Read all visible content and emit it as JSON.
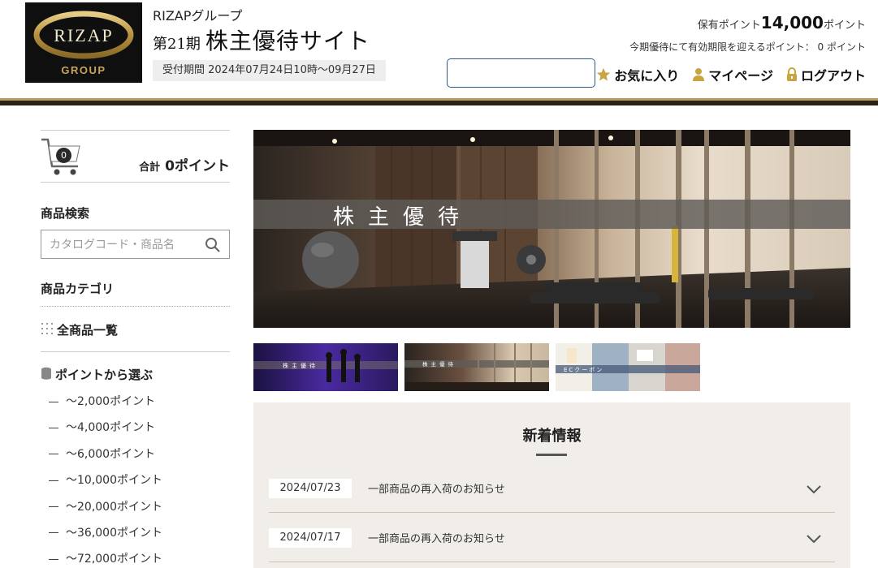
{
  "header": {
    "logo_text": "RIZAP",
    "logo_sub": "GROUP",
    "group_name": "RIZAPグループ",
    "period": "第21期",
    "title": "株主優待サイト",
    "reception": "受付期間 2024年07月24日10時～09月27日",
    "points_label": "保有ポイント",
    "points_value": "14,000",
    "points_unit": "ポイント",
    "expiring_text": "今期優待にて有効期限を迎えるポイント： 0 ポイント",
    "search_value": "",
    "nav": {
      "favorites": "お気に入り",
      "mypage": "マイページ",
      "logout": "ログアウト"
    }
  },
  "sidebar": {
    "cart_count": "0",
    "cart_total_label": "合計",
    "cart_total_value": "0ポイント",
    "search_title": "商品検索",
    "search_placeholder": "カタログコード・商品名",
    "category_title": "商品カテゴリ",
    "all_products": "全商品一覧",
    "by_points_title": "ポイントから選ぶ",
    "point_ranges": [
      "～2,000ポイント",
      "～4,000ポイント",
      "～6,000ポイント",
      "～10,000ポイント",
      "～20,000ポイント",
      "～36,000ポイント",
      "～72,000ポイント"
    ]
  },
  "hero": {
    "text": "株主優待"
  },
  "thumbnails": [
    {
      "text": "株主優待"
    },
    {
      "text": "株主優待"
    },
    {
      "text": "ECクーポン"
    }
  ],
  "news": {
    "title": "新着情報",
    "items": [
      {
        "date": "2024/07/23",
        "text": "一部商品の再入荷のお知らせ"
      },
      {
        "date": "2024/07/17",
        "text": "一部商品の再入荷のお知らせ"
      }
    ]
  },
  "colors": {
    "gold": "#b59a5c",
    "dark_brown": "#2b2118",
    "input_border": "#2c5a8c",
    "news_bg": "#f1eee9"
  }
}
